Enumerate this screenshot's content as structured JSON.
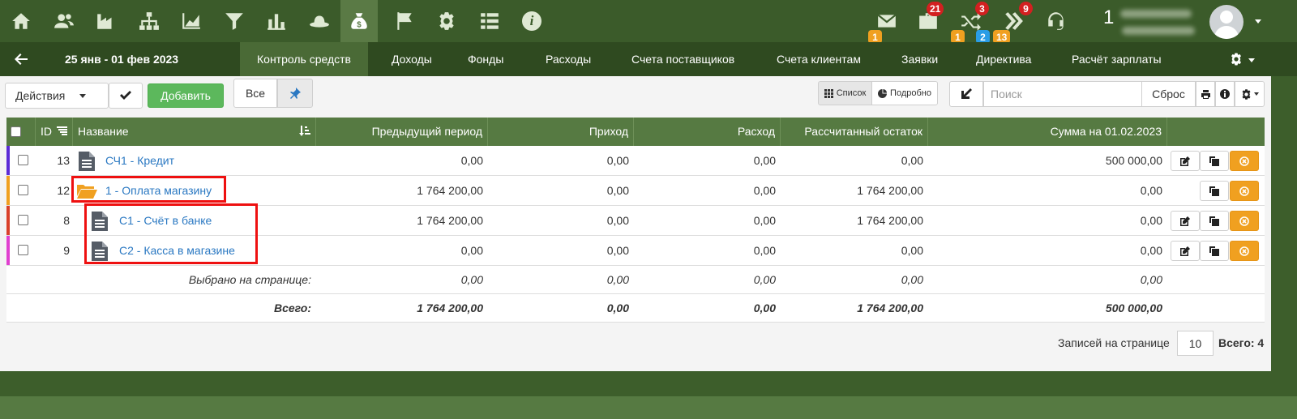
{
  "topbar": {
    "nav_icons": [
      "home-icon",
      "users-icon",
      "factory-icon",
      "org-chart-icon",
      "chart-area-icon",
      "filter-icon",
      "bar-chart-icon",
      "hat-icon",
      "money-bag-icon",
      "flag-icon",
      "gear-icon",
      "list-icon",
      "info-icon"
    ],
    "info_glyph": "i",
    "notifications": {
      "mail_badge": "1",
      "tasks_badge": "21",
      "shuffle_badge_top": "3",
      "shuffle_badge_left": "1",
      "shuffle_badge_right": "2",
      "forward_badge_top": "9",
      "forward_badge_bottom": "13"
    },
    "counter": "1"
  },
  "nav": {
    "date_range": "25 янв - 01 фев 2023",
    "tabs": [
      {
        "label": "Контроль средств",
        "active": true
      },
      {
        "label": "Доходы"
      },
      {
        "label": "Фонды"
      },
      {
        "label": "Расходы"
      },
      {
        "label": "Счета поставщиков"
      },
      {
        "label": "Счета клиентам"
      },
      {
        "label": "Заявки"
      },
      {
        "label": "Директива"
      },
      {
        "label": "Расчёт зарплаты"
      }
    ]
  },
  "toolbar": {
    "actions_label": "Действия",
    "add_label": "Добавить",
    "all_label": "Все",
    "list_view_label": "Список",
    "detail_view_label": "Подробно",
    "search_placeholder": "Поиск",
    "reset_label": "Сброс"
  },
  "table": {
    "headers": {
      "id": "ID",
      "name": "Название",
      "prev_period": "Предыдущий период",
      "income": "Приход",
      "expense": "Расход",
      "calc_balance": "Рассчитанный остаток",
      "sum_on_date": "Сумма на 01.02.2023"
    },
    "rows": [
      {
        "id": "13",
        "name": "СЧ1 - Кредит",
        "type": "document",
        "color": "#5b2bd6",
        "prev": "0,00",
        "income": "0,00",
        "expense": "0,00",
        "calc": "0,00",
        "sum": "500 000,00"
      },
      {
        "id": "12",
        "name": "1 - Оплата магазину",
        "type": "folder",
        "color": "#f0a020",
        "prev": "1 764 200,00",
        "income": "0,00",
        "expense": "0,00",
        "calc": "1 764 200,00",
        "sum": "0,00"
      },
      {
        "id": "8",
        "name": "С1 - Счёт в банке",
        "type": "document",
        "color": "#d9402a",
        "prev": "1 764 200,00",
        "income": "0,00",
        "expense": "0,00",
        "calc": "1 764 200,00",
        "sum": "0,00"
      },
      {
        "id": "9",
        "name": "С2 - Касса в магазине",
        "type": "document",
        "color": "#e040d0",
        "prev": "0,00",
        "income": "0,00",
        "expense": "0,00",
        "calc": "0,00",
        "sum": "0,00"
      }
    ],
    "selected": {
      "label": "Выбрано на странице:",
      "prev": "0,00",
      "income": "0,00",
      "expense": "0,00",
      "calc": "0,00",
      "sum": "0,00"
    },
    "total": {
      "label": "Всего:",
      "prev": "1 764 200,00",
      "income": "0,00",
      "expense": "0,00",
      "calc": "1 764 200,00",
      "sum": "500 000,00"
    }
  },
  "pagination": {
    "per_page_label": "Записей на странице",
    "per_page_value": "10",
    "total_label": "Всего: 4"
  },
  "colors": {
    "top_bar": "#3b5b2a",
    "nav_bar": "#2f4a20",
    "table_header": "#567a42",
    "add_button": "#5cb85c",
    "link": "#2a78c2",
    "highlight": "#ee1010",
    "cancel_button": "#f0a020"
  }
}
